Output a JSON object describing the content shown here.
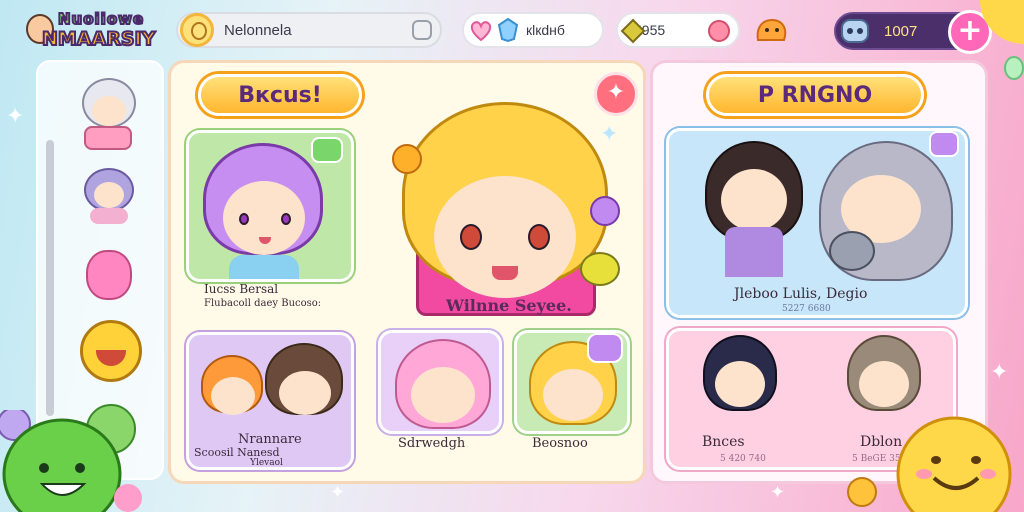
{
  "header": {
    "logo_line1": "Nuoiiowe",
    "logo_line2": "NMAARSIY",
    "player_name": "Nelonnela",
    "hearts_value": "кlкdнб",
    "gems_value": "5955",
    "coins_value": "1007",
    "add_button": "+"
  },
  "main_panel": {
    "title": "Bксus!",
    "featured": {
      "label": "Wilnne Seyee."
    },
    "cards": [
      {
        "id": "purple",
        "label_line1": "Iucss Bersal",
        "label_line2": "Flubacoll daey Bucoso:"
      },
      {
        "id": "duo",
        "label_line1": "Nrannare",
        "label_line2": "Scoosil   Nanesd",
        "label_line3": "Ylevaol"
      },
      {
        "id": "pink",
        "label": "Sdrwedgh"
      },
      {
        "id": "blonde",
        "label": "Beosnoo"
      }
    ]
  },
  "right_panel": {
    "title": "P RNGNO",
    "cards": [
      {
        "id": "top",
        "label": "Jleboo Lulis, Degio",
        "sub": "5227 6680"
      },
      {
        "id": "bottom",
        "label_left": "Bnces",
        "sub_left": "5 420 740",
        "label_right": "Dblon",
        "sub_right": "5 BeGE 35"
      }
    ]
  },
  "colors": {
    "accent_yellow": "#ffb62e",
    "accent_pink": "#ff67b8",
    "coin_bar": "#4a2f6a"
  }
}
